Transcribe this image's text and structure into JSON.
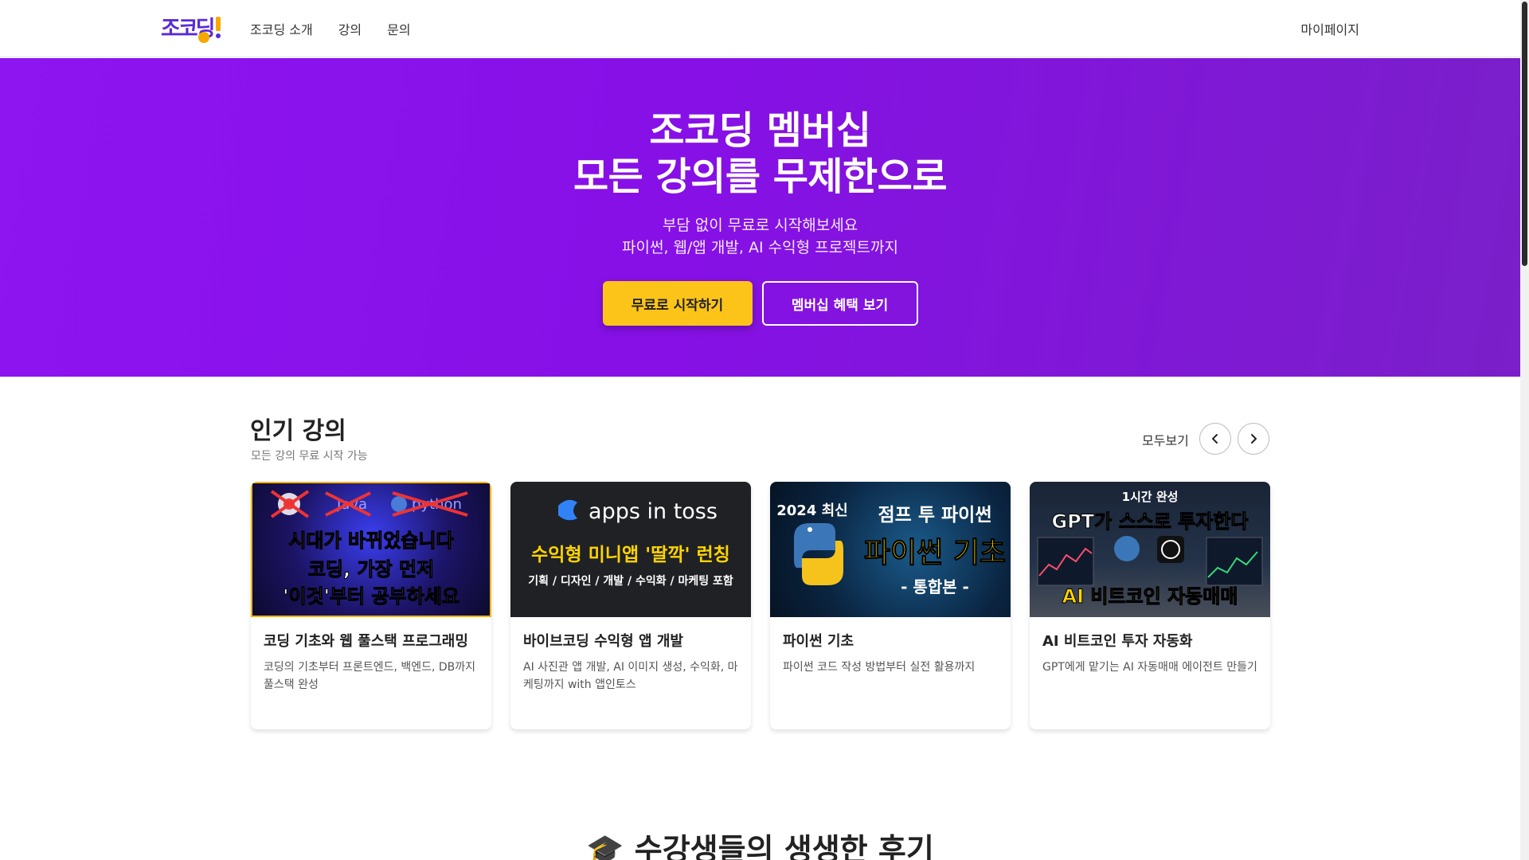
{
  "header": {
    "logo_text": "조코딩",
    "nav": [
      "조코딩 소개",
      "강의",
      "문의"
    ],
    "mypage": "마이페이지"
  },
  "hero": {
    "title_line1": "조코딩 멤버십",
    "title_line2": "모든 강의를 무제한으로",
    "sub_line1": "부담 없이 무료로 시작해보세요",
    "sub_line2": "파이썬, 웹/앱 개발, AI 수익형 프로젝트까지",
    "primary_button": "무료로 시작하기",
    "secondary_button": "멤버십 혜택 보기"
  },
  "popular": {
    "title": "인기 강의",
    "subtitle": "모든 강의 무료 시작 가능",
    "view_all": "모두보기",
    "courses": [
      {
        "title": "코딩 기초와 웹 풀스택 프로그래밍",
        "desc": "코딩의 기초부터 프론트엔드, 백엔드, DB까지 풀스택 완성",
        "thumb_line1": "시대가 바뀌었습니다",
        "thumb_line2": "코딩, 가장 먼저",
        "thumb_line3": "'이것'부터 공부하세요",
        "thumb_crossed_java": "Java",
        "thumb_crossed_python": "python"
      },
      {
        "title": "바이브코딩 수익형 앱 개발",
        "desc": "AI 사진관 앱 개발, AI 이미지 생성, 수익화, 마케팅까지 with 앱인토스",
        "thumb_brand": "apps in toss",
        "thumb_line1": "수익형 미니앱 '딸깍' 런칭",
        "thumb_line2": "기획 / 디자인 / 개발 / 수익화 / 마케팅 포함"
      },
      {
        "title": "파이썬 기초",
        "desc": "파이썬 코드 작성 방법부터 실전 활용까지",
        "thumb_line1": "2024 최신",
        "thumb_line2": "점프 투 파이썬",
        "thumb_line3": "파이썬 기초",
        "thumb_line4": "- 통합본 -"
      },
      {
        "title": "AI 비트코인 투자 자동화",
        "desc": "GPT에게 맡기는 AI 자동매매 에이전트 만들기",
        "thumb_badge": "1시간 완성",
        "thumb_line1": "GPT가 스스로 투자한다",
        "thumb_line2": "AI 비트코인 자동매매"
      }
    ]
  },
  "reviews": {
    "title": "🎓 수강생들의 생생한 후기"
  },
  "colors": {
    "hero_purple": "#8e14f0",
    "primary_yellow": "#fcc419"
  },
  "icons": {
    "prev": "chevron-left-icon",
    "next": "chevron-right-icon"
  }
}
